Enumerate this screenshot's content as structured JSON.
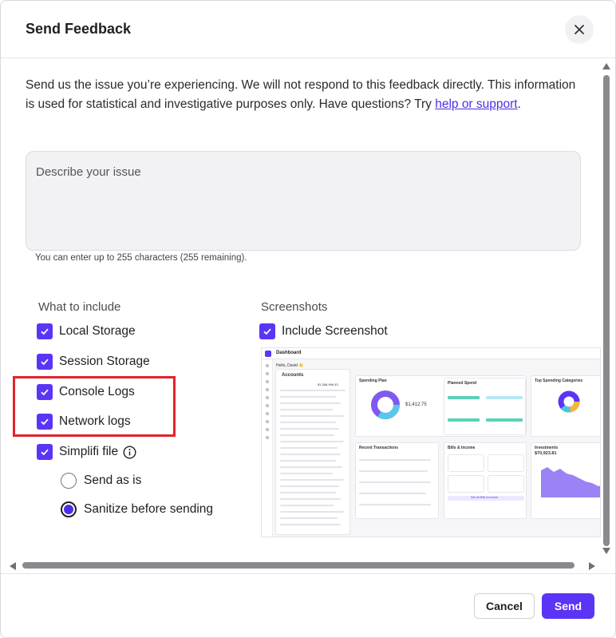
{
  "dialog": {
    "title": "Send Feedback",
    "intro_text": "Send us the issue you’re experiencing. We will not respond to this feedback directly. This information is used for statistical and investigative purposes only. Have questions? Try ",
    "intro_link": "help or support",
    "intro_end": ".",
    "textarea_placeholder": "Describe your issue",
    "char_counter": "You can enter up to 255 characters (255 remaining)."
  },
  "include": {
    "label": "What to include",
    "local_storage": "Local Storage",
    "session_storage": "Session Storage",
    "console_logs": "Console Logs",
    "network_logs": "Network logs",
    "simplifi_file": "Simplifi file",
    "send_as_is": "Send as is",
    "sanitize": "Sanitize before sending"
  },
  "screenshots": {
    "label": "Screenshots",
    "include_screenshot": "Include Screenshot",
    "preview": {
      "app_title": "Dashboard",
      "greeting": "Hello, David 👋",
      "accounts_title": "Accounts",
      "accounts_total": "$1,368,996.43",
      "spending_plan": "Spending Plan",
      "available_amount": "$1,412.75",
      "planned_spend": "Planned Spend",
      "top_spending": "Top Spending Categories",
      "recent_transactions": "Recent Transactions",
      "bills_income": "Bills & Income",
      "investments": "Investments",
      "investments_amount": "$70,923.81",
      "see_all_bills": "See all Bills & Income"
    }
  },
  "footer": {
    "cancel": "Cancel",
    "send": "Send"
  },
  "colors": {
    "accent": "#5b35f5",
    "highlight": "#e0252b",
    "link": "#4b2fe8"
  },
  "icons": {
    "close": "close-icon",
    "info": "info-icon",
    "check": "check-icon"
  }
}
